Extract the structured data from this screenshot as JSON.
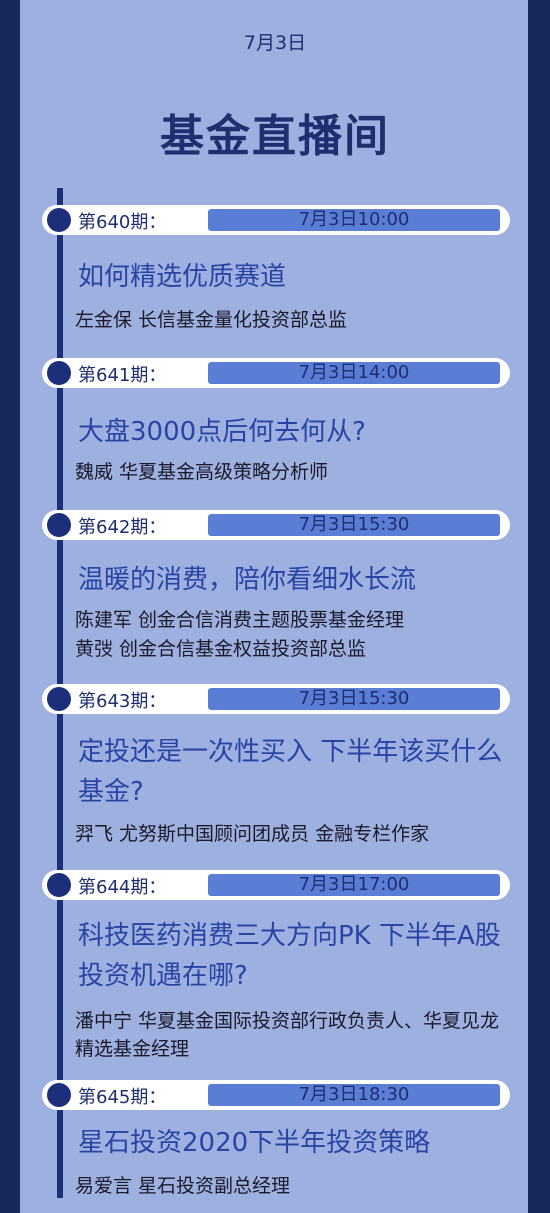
{
  "header": {
    "date": "7月3日",
    "title": "基金直播间"
  },
  "episodes": [
    {
      "label": "第640期：",
      "time": "7月3日10:00",
      "topic": "如何精选优质赛道",
      "speakers": [
        "左金保 长信基金量化投资部总监"
      ]
    },
    {
      "label": "第641期：",
      "time": "7月3日14:00",
      "topic": "大盘3000点后何去何从?",
      "speakers": [
        "魏威 华夏基金高级策略分析师"
      ]
    },
    {
      "label": "第642期：",
      "time": "7月3日15:30",
      "topic": "温暖的消费，陪你看细水长流",
      "speakers": [
        "陈建军 创金合信消费主题股票基金经理",
        "黄弢 创金合信基金权益投资部总监"
      ]
    },
    {
      "label": "第643期：",
      "time": "7月3日15:30",
      "topic": "定投还是一次性买入 下半年该买什么基金?",
      "speakers": [
        "羿飞 尤努斯中国顾问团成员 金融专栏作家"
      ]
    },
    {
      "label": "第644期：",
      "time": "7月3日17:00",
      "topic": "科技医药消费三大方向PK 下半年A股投资机遇在哪?",
      "speakers": [
        "潘中宁 华夏基金国际投资部行政负责人、华夏见龙精选基金经理"
      ]
    },
    {
      "label": "第645期：",
      "time": "7月3日18:30",
      "topic": "星石投资2020下半年投资策略",
      "speakers": [
        "易爱言 星石投资副总经理"
      ]
    }
  ]
}
